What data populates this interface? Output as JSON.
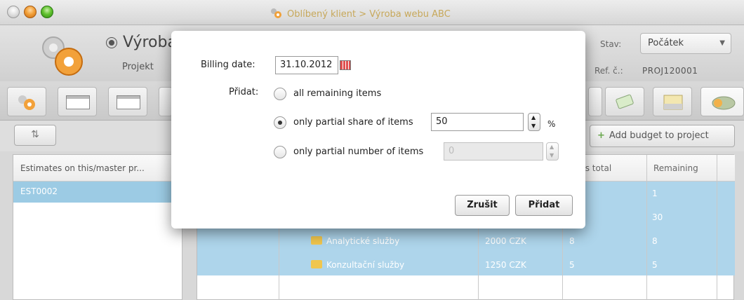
{
  "window": {
    "title": "Oblíbený klient > Výroba webu ABC"
  },
  "header": {
    "title": "Výroba webu ABC",
    "subtitle": "Projekt",
    "stav_label": "Stav:",
    "stav_value": "Počátek",
    "ref_label": "Ref. č.:",
    "ref_value": "PROJ120001"
  },
  "actions": {
    "add_budget": "Add budget to project"
  },
  "left_panel": {
    "header": "Estimates on this/master pr...",
    "rows": [
      "EST0002"
    ]
  },
  "table": {
    "headers": {
      "units_total": "ts total",
      "remaining": "Remaining"
    },
    "rows": [
      {
        "name": "",
        "price": "",
        "units": "",
        "remaining": "1"
      },
      {
        "name": "",
        "price": "",
        "units": "",
        "remaining": "30"
      },
      {
        "name": "Analytické služby",
        "price": "2000 CZK",
        "units": "8",
        "remaining": "8"
      },
      {
        "name": "Konzultační služby",
        "price": "1250 CZK",
        "units": "5",
        "remaining": "5"
      }
    ]
  },
  "dialog": {
    "billing_label": "Billing date:",
    "billing_value": "31.10.2012",
    "pridat_label": "Přidat:",
    "option_all": "all remaining items",
    "option_share": "only partial share of items",
    "share_value": "50",
    "percent": "%",
    "option_number": "only partial number of items",
    "number_value": "0",
    "cancel": "Zrušit",
    "submit": "Přidat"
  }
}
